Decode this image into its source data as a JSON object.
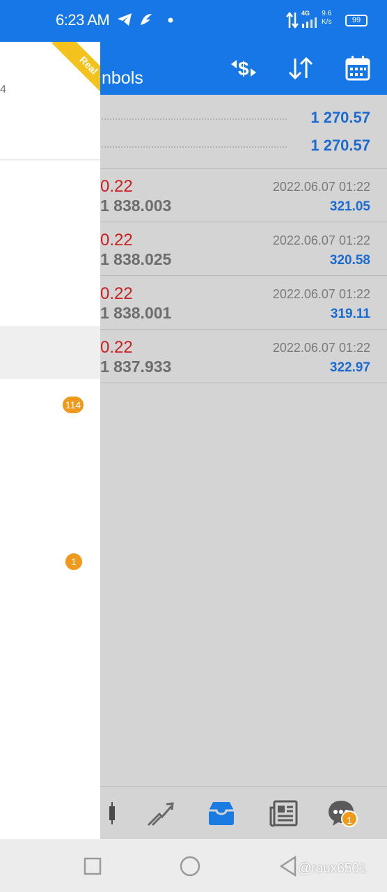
{
  "status_bar": {
    "time": "6:23 AM",
    "net_type": "4G",
    "net_speed_value": "9.6",
    "net_speed_unit": "K/s",
    "battery": "99",
    "icons": [
      "telegram-icon",
      "app-icon",
      "dot-icon",
      "data-arrows-icon",
      "signal-icon",
      "battery-icon"
    ]
  },
  "header": {
    "title_partial": "nbols",
    "actions": [
      "currency-exchange-icon",
      "sort-icon",
      "calendar-icon"
    ]
  },
  "summary": {
    "rows": [
      {
        "value": "1 270.57"
      },
      {
        "value": "1 270.57"
      }
    ]
  },
  "trades": [
    {
      "profit": "0.22",
      "price": "1 838.003",
      "date": "2022.06.07 01:22",
      "value": "321.05"
    },
    {
      "profit": "0.22",
      "price": "1 838.025",
      "date": "2022.06.07 01:22",
      "value": "320.58"
    },
    {
      "profit": "0.22",
      "price": "1 838.001",
      "date": "2022.06.07 01:22",
      "value": "319.11"
    },
    {
      "profit": "0.22",
      "price": "1 837.933",
      "date": "2022.06.07 01:22",
      "value": "322.97"
    }
  ],
  "drawer": {
    "account_partial": "4",
    "ribbon_label": "Real",
    "badges": [
      "114",
      "1"
    ]
  },
  "bottom_nav": {
    "items": [
      "quotes-icon",
      "chart-icon",
      "trade-icon",
      "history-icon",
      "news-icon",
      "chat-icon"
    ],
    "chat_badge": "1"
  },
  "watermark": "@roux6501",
  "colors": {
    "primary": "#1877e6",
    "profit_red": "#c82020",
    "value_blue": "#1a6bd0",
    "badge_orange": "#ef9a1a",
    "ribbon_yellow": "#f4c21c"
  }
}
